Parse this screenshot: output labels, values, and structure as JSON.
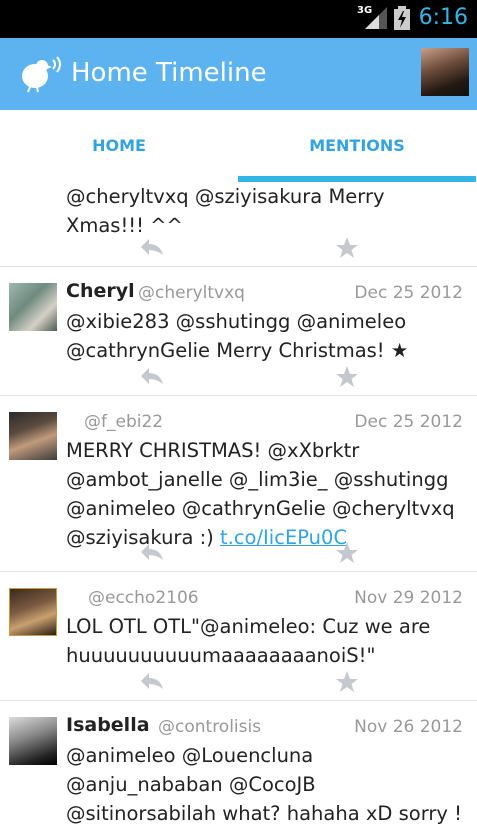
{
  "status": {
    "network": "3G",
    "time": "6:16"
  },
  "header": {
    "title": "Home Timeline"
  },
  "tabs": [
    {
      "label": "HOME"
    },
    {
      "label": "MENTIONS"
    }
  ],
  "tweets": [
    {
      "name": "",
      "handle": "",
      "date": "",
      "text": "@cheryltvxq @sziyisakura Merry Xmas!!! ^^"
    },
    {
      "name": "Cheryl",
      "handle": "@cheryltvxq",
      "date": "Dec 25 2012",
      "text": "@xibie283 @sshutingg @animeleo @cathrynGelie Merry Christmas! ★"
    },
    {
      "name": "",
      "handle": "@f_ebi22",
      "date": "Dec 25 2012",
      "text": "MERRY CHRISTMAS! @xXbrktr @ambot_janelle @_lim3ie_ @sshutingg @animeleo @cathrynGelie @cheryltvxq @sziyisakura :)",
      "link": "t.co/IicEPu0C"
    },
    {
      "name": "",
      "handle": "@eccho2106",
      "date": "Nov 29 2012",
      "text": "LOL OTL OTL\"@animeleo: Cuz we are huuuuuuuuuumaaaaaaaanoiS!\""
    },
    {
      "name": "Isabella",
      "handle": "@controlisis",
      "date": "Nov 26 2012",
      "text": "@animeleo @Louencluna @anju_nababan @CocoJB @sitinorsabilah what? hahaha xD sorry !"
    }
  ],
  "icons": {
    "reply": "reply-icon",
    "favorite": "star-icon",
    "logo": "bird-logo-icon"
  },
  "colors": {
    "action_bar": "#5cb3f0",
    "accent": "#33b5e5",
    "link": "#33a3e0"
  }
}
